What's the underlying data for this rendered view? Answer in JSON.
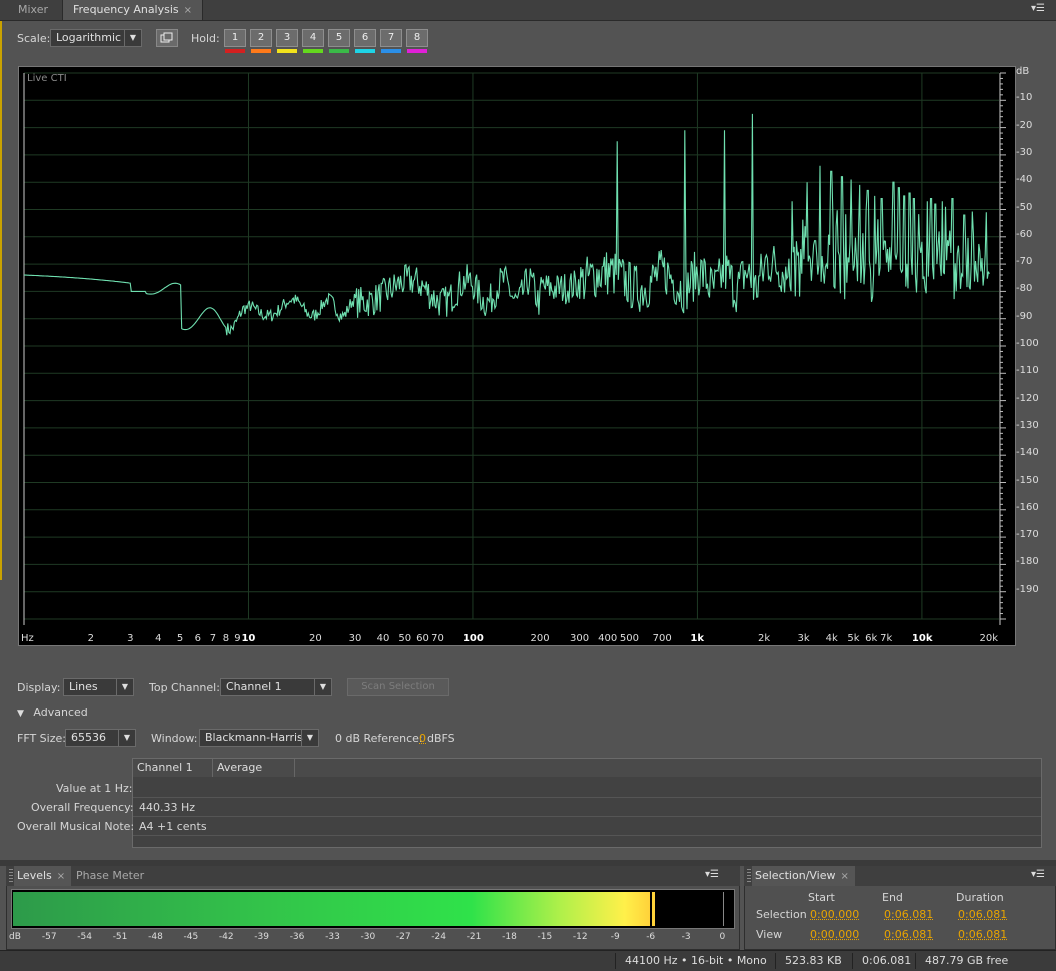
{
  "tabs": {
    "mixer": "Mixer",
    "frequency_analysis": "Frequency Analysis",
    "close": "×"
  },
  "toolbar": {
    "scale_label": "Scale:",
    "scale_value": "Logarithmic",
    "hold_label": "Hold:",
    "hold_buttons": [
      {
        "label": "1",
        "color": "#d42020"
      },
      {
        "label": "2",
        "color": "#ff7a1a"
      },
      {
        "label": "3",
        "color": "#f2e21c"
      },
      {
        "label": "4",
        "color": "#64d81e"
      },
      {
        "label": "5",
        "color": "#3aba48"
      },
      {
        "label": "6",
        "color": "#1ed4e6"
      },
      {
        "label": "7",
        "color": "#2b8fe8"
      },
      {
        "label": "8",
        "color": "#e020d8"
      }
    ]
  },
  "graph": {
    "cursor_label": "Live CTI",
    "y_unit": "dB",
    "y_labels": [
      "-10",
      "-20",
      "-30",
      "-40",
      "-50",
      "-60",
      "-70",
      "-80",
      "-90",
      "-100",
      "-110",
      "-120",
      "-130",
      "-140",
      "-150",
      "-160",
      "-170",
      "-180",
      "-190"
    ],
    "x_unit": "Hz",
    "x_labels": [
      "2",
      "3",
      "4",
      "5",
      "6",
      "7",
      "8",
      "9",
      "10",
      "20",
      "30",
      "40",
      "50",
      "60",
      "70",
      "100",
      "200",
      "300",
      "400",
      "500",
      "700",
      "1k",
      "2k",
      "3k",
      "4k",
      "5k",
      "6k",
      "7k",
      "10k",
      "20k"
    ],
    "line_color": "#6fe0b0",
    "grid_color": "#1f3a24"
  },
  "controls": {
    "display_label": "Display:",
    "display_value": "Lines",
    "top_channel_label": "Top Channel:",
    "top_channel_value": "Channel 1",
    "scan_selection": "Scan Selection",
    "advanced_label": "Advanced",
    "fft_size_label": "FFT Size:",
    "fft_size_value": "65536",
    "window_label": "Window:",
    "window_value": "Blackmann-Harris",
    "reference_label": "0 dB Reference:",
    "reference_value": "0",
    "reference_unit": "dBFS"
  },
  "table": {
    "col_channel": "Channel 1",
    "col_average": "Average",
    "rows": [
      {
        "label": "Value at 1 Hz:",
        "value": ""
      },
      {
        "label": "Overall Frequency:",
        "value": "440.33 Hz"
      },
      {
        "label": "Overall Musical Note:",
        "value": "A4 +1 cents"
      }
    ]
  },
  "levels_panel": {
    "tab_levels": "Levels",
    "tab_phase_meter": "Phase Meter",
    "scale_labels": [
      "dB",
      "-57",
      "-54",
      "-51",
      "-48",
      "-45",
      "-42",
      "-39",
      "-36",
      "-33",
      "-30",
      "-27",
      "-24",
      "-21",
      "-18",
      "-15",
      "-12",
      "-9",
      "-6",
      "-3",
      "0"
    ]
  },
  "selection_panel": {
    "tab": "Selection/View",
    "col_start": "Start",
    "col_end": "End",
    "col_duration": "Duration",
    "selection_label": "Selection",
    "view_label": "View",
    "selection_start": "0:00.000",
    "selection_end": "0:06.081",
    "selection_duration": "0:06.081",
    "view_start": "0:00.000",
    "view_end": "0:06.081",
    "view_duration": "0:06.081"
  },
  "status": {
    "format": "44100 Hz • 16-bit • Mono",
    "size": "523.83 KB",
    "duration": "0:06.081",
    "free": "487.79 GB free"
  }
}
